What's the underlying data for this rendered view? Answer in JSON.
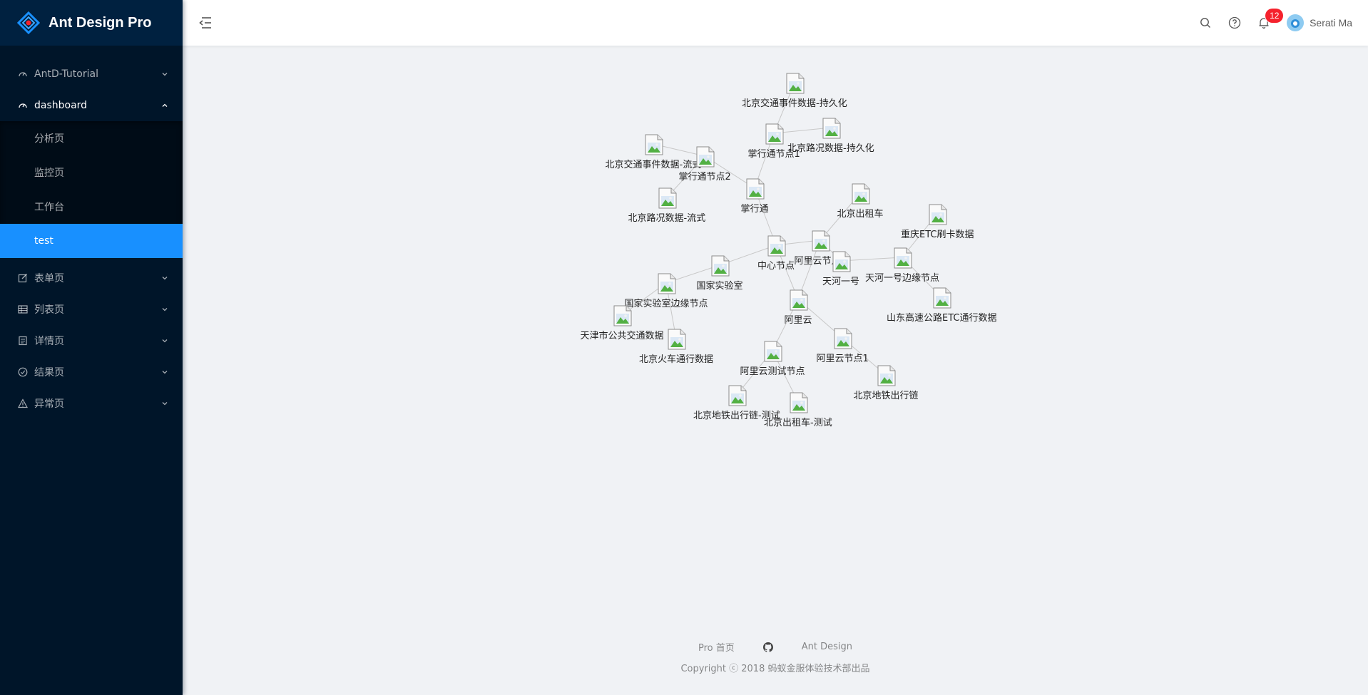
{
  "app": {
    "title": "Ant Design Pro"
  },
  "sidebar": {
    "items": [
      {
        "label": "AntD-Tutorial",
        "icon": "dashboard-icon"
      },
      {
        "label": "dashboard",
        "icon": "dashboard-icon",
        "open": true,
        "children": [
          {
            "label": "分析页"
          },
          {
            "label": "监控页"
          },
          {
            "label": "工作台"
          },
          {
            "label": "test",
            "selected": true
          }
        ]
      },
      {
        "label": "表单页",
        "icon": "form-icon"
      },
      {
        "label": "列表页",
        "icon": "table-icon"
      },
      {
        "label": "详情页",
        "icon": "profile-icon"
      },
      {
        "label": "结果页",
        "icon": "check-circle-icon"
      },
      {
        "label": "异常页",
        "icon": "warning-icon"
      }
    ]
  },
  "header": {
    "notification_count": "12",
    "user_name": "Serati Ma"
  },
  "graph": {
    "nodes": [
      {
        "id": "n1",
        "label": "北京交通事件数据-持久化"
      },
      {
        "id": "n2",
        "label": "掌行通节点1"
      },
      {
        "id": "n3",
        "label": "北京路况数据-持久化"
      },
      {
        "id": "n4",
        "label": "北京交通事件数据-流式"
      },
      {
        "id": "n5",
        "label": "掌行通节点2"
      },
      {
        "id": "n6",
        "label": "北京路况数据-流式"
      },
      {
        "id": "n7",
        "label": "掌行通"
      },
      {
        "id": "n8",
        "label": "北京出租车"
      },
      {
        "id": "n9",
        "label": "重庆ETC刷卡数据"
      },
      {
        "id": "n10",
        "label": "中心节点"
      },
      {
        "id": "n11",
        "label": "阿里云节点2"
      },
      {
        "id": "n12",
        "label": "天河一号"
      },
      {
        "id": "n13",
        "label": "天河一号边缘节点"
      },
      {
        "id": "n14",
        "label": "国家实验室"
      },
      {
        "id": "n15",
        "label": "国家实验室边缘节点"
      },
      {
        "id": "n16",
        "label": "山东高速公路ETC通行数据"
      },
      {
        "id": "n17",
        "label": "阿里云"
      },
      {
        "id": "n18",
        "label": "天津市公共交通数据"
      },
      {
        "id": "n19",
        "label": "北京火车通行数据"
      },
      {
        "id": "n20",
        "label": "阿里云节点1"
      },
      {
        "id": "n21",
        "label": "阿里云测试节点"
      },
      {
        "id": "n22",
        "label": "北京地铁出行链"
      },
      {
        "id": "n23",
        "label": "北京地铁出行链-测试"
      },
      {
        "id": "n24",
        "label": "北京出租车-测试"
      }
    ],
    "edges": [
      [
        "n1",
        "n2"
      ],
      [
        "n2",
        "n3"
      ],
      [
        "n2",
        "n7"
      ],
      [
        "n4",
        "n5"
      ],
      [
        "n5",
        "n6"
      ],
      [
        "n5",
        "n7"
      ],
      [
        "n7",
        "n10"
      ],
      [
        "n10",
        "n11"
      ],
      [
        "n10",
        "n14"
      ],
      [
        "n10",
        "n17"
      ],
      [
        "n11",
        "n8"
      ],
      [
        "n11",
        "n17"
      ],
      [
        "n11",
        "n12"
      ],
      [
        "n12",
        "n13"
      ],
      [
        "n13",
        "n9"
      ],
      [
        "n13",
        "n16"
      ],
      [
        "n14",
        "n15"
      ],
      [
        "n15",
        "n18"
      ],
      [
        "n15",
        "n19"
      ],
      [
        "n17",
        "n20"
      ],
      [
        "n17",
        "n21"
      ],
      [
        "n20",
        "n22"
      ],
      [
        "n21",
        "n23"
      ],
      [
        "n21",
        "n24"
      ]
    ]
  },
  "footer": {
    "links": [
      "Pro 首页",
      "Ant Design"
    ],
    "github_icon": "github-icon",
    "copyright": "Copyright ⓒ 2018 蚂蚁金服体验技术部出品"
  }
}
